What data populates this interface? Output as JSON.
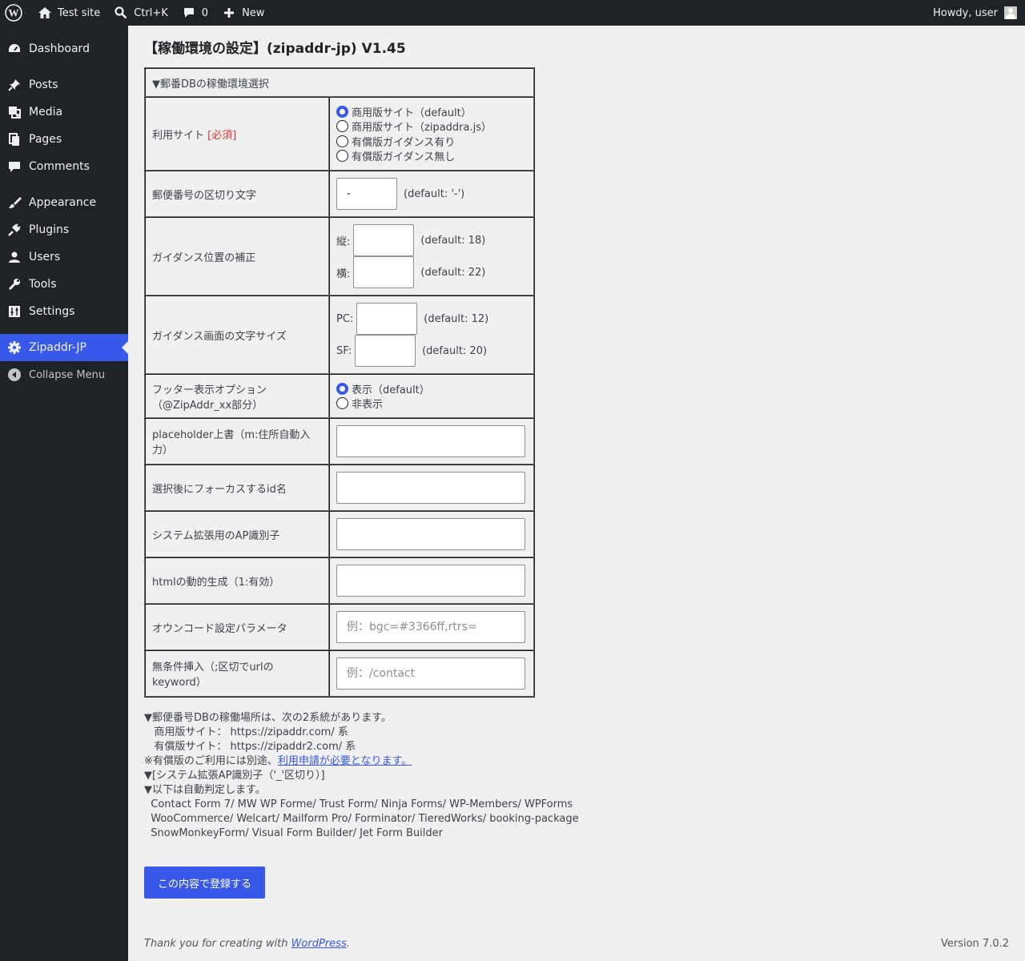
{
  "adminbar": {
    "site_name": "Test site",
    "search_shortcut": "Ctrl+K",
    "comments_count": "0",
    "new_label": "New",
    "howdy": "Howdy, user"
  },
  "sidebar": {
    "items": [
      {
        "label": "Dashboard",
        "icon": "dashboard-icon"
      },
      {
        "label": "Posts",
        "icon": "pin-icon"
      },
      {
        "label": "Media",
        "icon": "media-icon"
      },
      {
        "label": "Pages",
        "icon": "pages-icon"
      },
      {
        "label": "Comments",
        "icon": "comment-icon"
      },
      {
        "label": "Appearance",
        "icon": "brush-icon"
      },
      {
        "label": "Plugins",
        "icon": "plugin-icon"
      },
      {
        "label": "Users",
        "icon": "user-icon"
      },
      {
        "label": "Tools",
        "icon": "wrench-icon"
      },
      {
        "label": "Settings",
        "icon": "sliders-icon"
      },
      {
        "label": "Zipaddr-JP",
        "icon": "gear-icon",
        "current": true
      }
    ],
    "collapse_label": "Collapse Menu"
  },
  "page": {
    "title": "【稼働環境の設定】(zipaddr-jp) V1.45",
    "section_header": "▼郵番DBの稼働環境選択",
    "rows": {
      "site": {
        "label": "利用サイト",
        "required": "[必須]",
        "options": [
          "商用版サイト（default）",
          "商用版サイト（zipaddra.js）",
          "有償版ガイダンス有り",
          "有償版ガイダンス無し"
        ],
        "selected": 0
      },
      "separator": {
        "label": "郵便番号の区切り文字",
        "value": "-",
        "default": "(default: '-')"
      },
      "position": {
        "label": "ガイダンス位置の補正",
        "v_label": "縦:",
        "v_default": "(default: 18)",
        "h_label": "横:",
        "h_default": "(default: 22)"
      },
      "font_size": {
        "label": "ガイダンス画面の文字サイズ",
        "pc_label": "PC:",
        "pc_default": "(default: 12)",
        "sf_label": "SF:",
        "sf_default": "(default: 20)"
      },
      "footer": {
        "label_1": "フッター表示オプション",
        "label_2": "（@ZipAddr_xx部分）",
        "options": [
          "表示（default）",
          "非表示"
        ],
        "selected": 0
      },
      "placeholder": {
        "label": "placeholder上書（m:住所自動入力）",
        "value": ""
      },
      "focus": {
        "label": "選択後にフォーカスするid名",
        "value": ""
      },
      "ap_id": {
        "label": "システム拡張用のAP識別子",
        "value": ""
      },
      "html_gen": {
        "label": "htmlの動的生成（1:有効）",
        "value": ""
      },
      "owncode": {
        "label": "オウンコード設定パラメータ",
        "placeholder": "例：bgc=#3366ff,rtrs="
      },
      "unconditional": {
        "label": "無条件挿入（;区切でurlのkeyword）",
        "placeholder": "例：/contact"
      }
    },
    "notes": {
      "line1": "▼郵便番号DBの稼働場所は、次の2系統があります。",
      "line2": "   商用版サイト： https://zipaddr.com/ 系",
      "line3": "   有償版サイト： https://zipaddr2.com/ 系",
      "line4_prefix": "※有償版のご利用には別途、",
      "line4_link": "利用申請が必要となります。",
      "line5": "▼[システム拡張AP識別子（'_'区切り）]",
      "line6": "▼以下は自動判定します。",
      "line7": "  Contact Form 7/ MW WP Forme/ Trust Form/ Ninja Forms/ WP-Members/ WPForms",
      "line8": "  WooCommerce/ Welcart/ Mailform Pro/ Forminator/ TieredWorks/ booking-package",
      "line9": "  SnowMonkeyForm/ Visual Form Builder/ Jet Form Builder"
    },
    "submit_label": "この内容で登録する"
  },
  "footer": {
    "thanks_prefix": "Thank you for creating with ",
    "wp_link": "WordPress",
    "thanks_suffix": ".",
    "version": "Version 7.0.2"
  },
  "colors": {
    "accent": "#3858e9",
    "admin_bg": "#1d2327",
    "page_bg": "#f0f0f1",
    "required": "#d63638"
  }
}
